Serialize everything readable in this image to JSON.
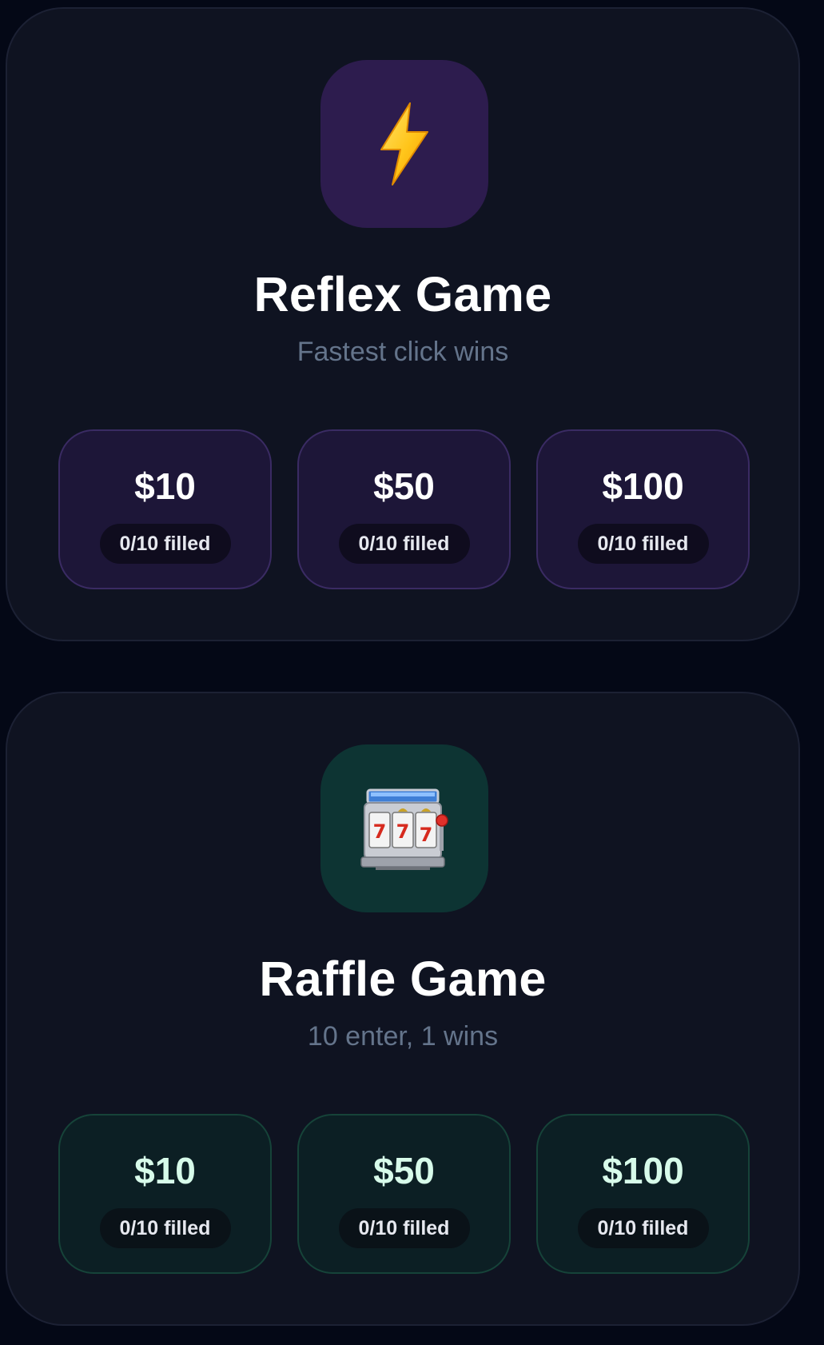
{
  "games": [
    {
      "title": "Reflex Game",
      "subtitle": "Fastest click wins",
      "icon": "lightning-icon",
      "accent": "#2d1c4e",
      "tiers": [
        {
          "price": "$10",
          "filled": "0/10 filled"
        },
        {
          "price": "$50",
          "filled": "0/10 filled"
        },
        {
          "price": "$100",
          "filled": "0/10 filled"
        }
      ]
    },
    {
      "title": "Raffle Game",
      "subtitle": "10 enter, 1 wins",
      "icon": "slot-machine-icon",
      "accent": "#0d3433",
      "tiers": [
        {
          "price": "$10",
          "filled": "0/10 filled"
        },
        {
          "price": "$50",
          "filled": "0/10 filled"
        },
        {
          "price": "$100",
          "filled": "0/10 filled"
        }
      ]
    }
  ]
}
